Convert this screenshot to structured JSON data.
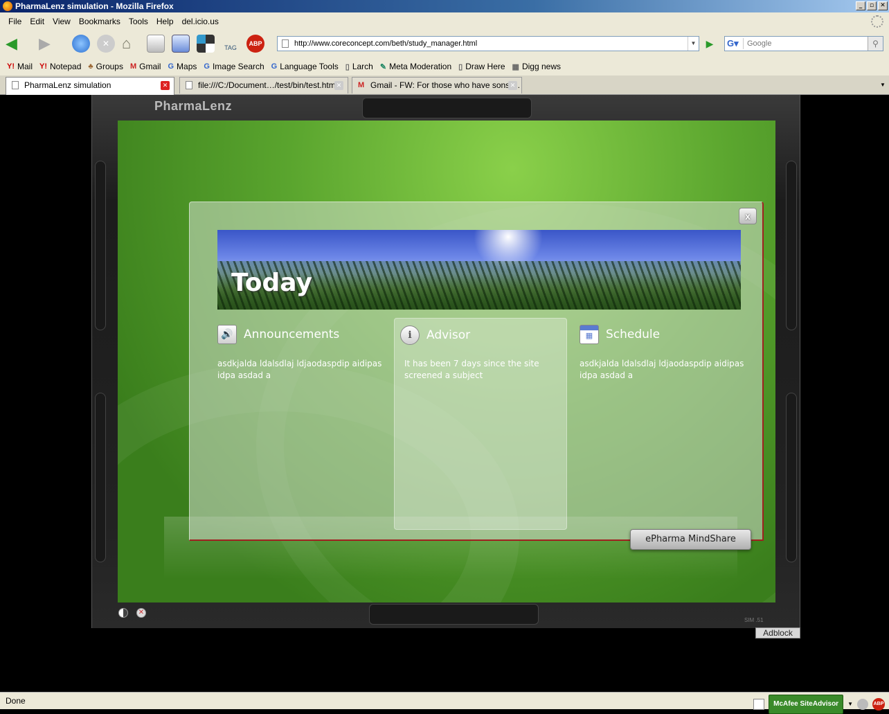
{
  "window": {
    "title": "PharmaLenz simulation - Mozilla Firefox"
  },
  "menu": [
    "File",
    "Edit",
    "View",
    "Bookmarks",
    "Tools",
    "Help",
    "del.icio.us"
  ],
  "nav": {
    "url": "http://www.coreconcept.com/beth/study_manager.html",
    "search_placeholder": "Google",
    "tag_label": "TAG",
    "abp_label": "ABP"
  },
  "bookmarks": [
    {
      "icon": "Y!",
      "label": "Mail"
    },
    {
      "icon": "Y!",
      "label": "Notepad"
    },
    {
      "icon": "♣",
      "label": "Groups"
    },
    {
      "icon": "M",
      "label": "Gmail"
    },
    {
      "icon": "G",
      "label": "Maps"
    },
    {
      "icon": "G",
      "label": "Image Search"
    },
    {
      "icon": "G",
      "label": "Language Tools"
    },
    {
      "icon": "▯",
      "label": "Larch"
    },
    {
      "icon": "✎",
      "label": "Meta Moderation"
    },
    {
      "icon": "▯",
      "label": "Draw Here"
    },
    {
      "icon": "▦",
      "label": "Digg news"
    }
  ],
  "tabs": [
    {
      "label": "PharmaLenz simulation"
    },
    {
      "label": "file:///C:/Document…/test/bin/test.html"
    },
    {
      "label": "Gmail - FW: For those who have sons …"
    }
  ],
  "app": {
    "title": "PharmaLenz",
    "dialog": {
      "close_label": "x",
      "banner_title": "Today",
      "columns": [
        {
          "title": "Announcements",
          "text": "asdkjalda ldalsdlaj ldjaodaspdip aidipas idpa asdad a"
        },
        {
          "title": "Advisor",
          "text": "It has been 7 days since the site screened a subject"
        },
        {
          "title": "Schedule",
          "text": "asdkjalda ldalsdlaj ldjaodaspdip aidipas idpa asdad a"
        }
      ]
    },
    "mindshare_label": "ePharma MindShare",
    "sim_version": "SIM .51",
    "adblock_label": "Adblock"
  },
  "status": {
    "text": "Done",
    "mcafee": "McAfee SiteAdvisor",
    "abp": "ABP"
  },
  "colors": {
    "stage_green": "#5aa52e",
    "close_red": "#dd2222"
  }
}
